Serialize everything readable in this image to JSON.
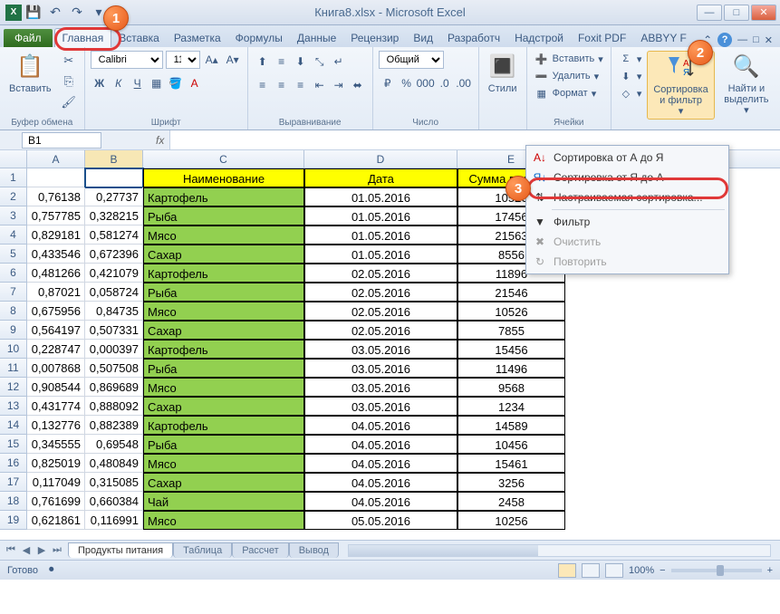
{
  "window": {
    "title": "Книга8.xlsx - Microsoft Excel"
  },
  "tabs": {
    "file": "Файл",
    "items": [
      "Главная",
      "Вставка",
      "Разметка",
      "Формулы",
      "Данные",
      "Рецензир",
      "Вид",
      "Разработч",
      "Надстрой",
      "Foxit PDF",
      "ABBYY F"
    ]
  },
  "ribbon": {
    "clipboard": {
      "paste": "Вставить",
      "label": "Буфер обмена"
    },
    "font": {
      "name": "Calibri",
      "size": "11",
      "label": "Шрифт"
    },
    "align": {
      "label": "Выравнивание"
    },
    "number": {
      "format": "Общий",
      "label": "Число"
    },
    "styles": {
      "label": "Стили"
    },
    "cells": {
      "insert": "Вставить",
      "delete": "Удалить",
      "format": "Формат",
      "label": "Ячейки"
    },
    "editing": {
      "sort": "Сортировка и фильтр",
      "find": "Найти и выделить"
    }
  },
  "namebox": "B1",
  "columns": [
    "A",
    "B",
    "C",
    "D",
    "E"
  ],
  "headers": {
    "c": "Наименование",
    "d": "Дата",
    "e": "Сумма выручки"
  },
  "rows": [
    {
      "n": 2,
      "a": "0,76138",
      "b": "0,27737",
      "c": "Картофель",
      "d": "01.05.2016",
      "e": "10526"
    },
    {
      "n": 3,
      "a": "0,757785",
      "b": "0,328215",
      "c": "Рыба",
      "d": "01.05.2016",
      "e": "17456"
    },
    {
      "n": 4,
      "a": "0,829181",
      "b": "0,581274",
      "c": "Мясо",
      "d": "01.05.2016",
      "e": "21563"
    },
    {
      "n": 5,
      "a": "0,433546",
      "b": "0,672396",
      "c": "Сахар",
      "d": "01.05.2016",
      "e": "8556"
    },
    {
      "n": 6,
      "a": "0,481266",
      "b": "0,421079",
      "c": "Картофель",
      "d": "02.05.2016",
      "e": "11896"
    },
    {
      "n": 7,
      "a": "0,87021",
      "b": "0,058724",
      "c": "Рыба",
      "d": "02.05.2016",
      "e": "21546"
    },
    {
      "n": 8,
      "a": "0,675956",
      "b": "0,84735",
      "c": "Мясо",
      "d": "02.05.2016",
      "e": "10526"
    },
    {
      "n": 9,
      "a": "0,564197",
      "b": "0,507331",
      "c": "Сахар",
      "d": "02.05.2016",
      "e": "7855"
    },
    {
      "n": 10,
      "a": "0,228747",
      "b": "0,000397",
      "c": "Картофель",
      "d": "03.05.2016",
      "e": "15456"
    },
    {
      "n": 11,
      "a": "0,007868",
      "b": "0,507508",
      "c": "Рыба",
      "d": "03.05.2016",
      "e": "11496"
    },
    {
      "n": 12,
      "a": "0,908544",
      "b": "0,869689",
      "c": "Мясо",
      "d": "03.05.2016",
      "e": "9568"
    },
    {
      "n": 13,
      "a": "0,431774",
      "b": "0,888092",
      "c": "Сахар",
      "d": "03.05.2016",
      "e": "1234"
    },
    {
      "n": 14,
      "a": "0,132776",
      "b": "0,882389",
      "c": "Картофель",
      "d": "04.05.2016",
      "e": "14589"
    },
    {
      "n": 15,
      "a": "0,345555",
      "b": "0,69548",
      "c": "Рыба",
      "d": "04.05.2016",
      "e": "10456"
    },
    {
      "n": 16,
      "a": "0,825019",
      "b": "0,480849",
      "c": "Мясо",
      "d": "04.05.2016",
      "e": "15461"
    },
    {
      "n": 17,
      "a": "0,117049",
      "b": "0,315085",
      "c": "Сахар",
      "d": "04.05.2016",
      "e": "3256"
    },
    {
      "n": 18,
      "a": "0,761699",
      "b": "0,660384",
      "c": "Чай",
      "d": "04.05.2016",
      "e": "2458"
    },
    {
      "n": 19,
      "a": "0,621861",
      "b": "0,116991",
      "c": "Мясо",
      "d": "05.05.2016",
      "e": "10256"
    }
  ],
  "sheets": {
    "active": "Продукты питания",
    "others": [
      "Таблица",
      "Рассчет",
      "Вывод"
    ]
  },
  "status": {
    "ready": "Готово",
    "zoom": "100%"
  },
  "dropdown": {
    "sort_az": "Сортировка от А до Я",
    "sort_za": "Сортировка от Я до А",
    "custom": "Настраиваемая сортировка...",
    "filter": "Фильтр",
    "clear": "Очистить",
    "reapply": "Повторить"
  },
  "callouts": {
    "c1": "1",
    "c2": "2",
    "c3": "3"
  }
}
